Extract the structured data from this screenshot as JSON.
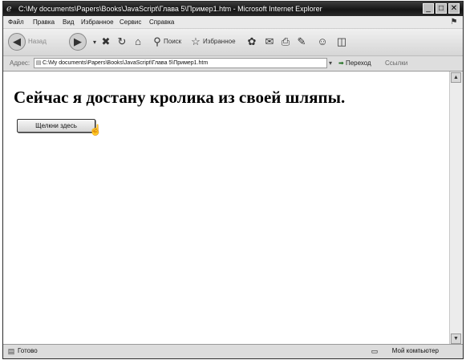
{
  "window": {
    "title": "C:\\My documents\\Papers\\Books\\JavaScript\\Глава 5\\Пример1.htm - Microsoft Internet Explorer",
    "buttons": {
      "minimize": "_",
      "maximize": "□",
      "close": "✕"
    }
  },
  "menu": {
    "items": [
      "Файл",
      "Правка",
      "Вид",
      "Избранное",
      "Сервис",
      "Справка"
    ]
  },
  "toolbar": {
    "back_label": "Назад",
    "search_label": "Поиск",
    "favorites_label": "Избранное"
  },
  "address": {
    "label": "Адрес:",
    "value": "C:\\My documents\\Papers\\Books\\JavaScript\\Глава 5\\Пример1.htm",
    "go_label": "Переход",
    "links_label": "Ссылки"
  },
  "page": {
    "heading": "Сейчас я достану кролика из своей шляпы.",
    "button_label": "Щелкни здесь"
  },
  "status": {
    "text": "Готово",
    "zone": "Мой компьютер"
  },
  "icons": {
    "ie": "ie-logo-icon",
    "back": "back-arrow-icon",
    "forward": "forward-arrow-icon",
    "stop": "stop-icon",
    "refresh": "refresh-icon",
    "home": "home-icon",
    "search": "search-icon",
    "favorites": "star-icon",
    "media": "media-icon",
    "mail": "mail-icon",
    "print": "printer-icon",
    "edit": "edit-icon",
    "messenger": "messenger-icon",
    "windows_flag": "windows-flag-icon",
    "page": "page-icon",
    "go": "go-arrow-icon",
    "computer": "computer-icon"
  }
}
